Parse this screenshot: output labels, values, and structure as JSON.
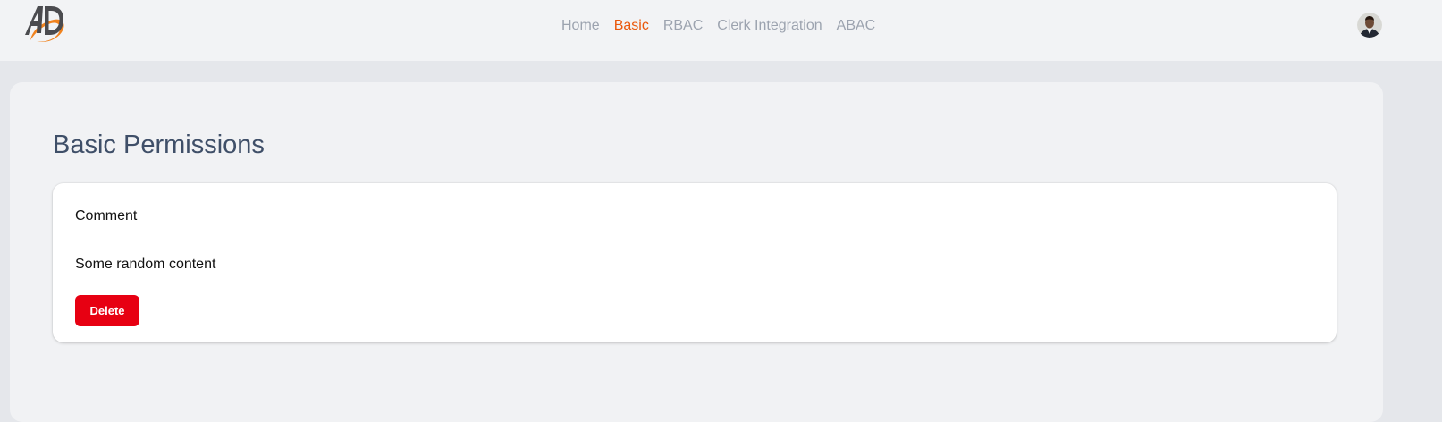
{
  "brand": {
    "logo_text": "AD",
    "logo_icon": "ad-logo-icon",
    "accent": "#ea580c"
  },
  "nav": {
    "items": [
      {
        "label": "Home",
        "active": false
      },
      {
        "label": "Basic",
        "active": true
      },
      {
        "label": "RBAC",
        "active": false
      },
      {
        "label": "Clerk Integration",
        "active": false
      },
      {
        "label": "ABAC",
        "active": false
      }
    ]
  },
  "user": {
    "avatar_icon": "user-avatar"
  },
  "main": {
    "title": "Basic Permissions",
    "card": {
      "title": "Comment",
      "body": "Some random content",
      "delete_label": "Delete"
    }
  },
  "colors": {
    "danger": "#e70012",
    "title": "#3f4f68",
    "nav_inactive": "#9ca3af"
  }
}
